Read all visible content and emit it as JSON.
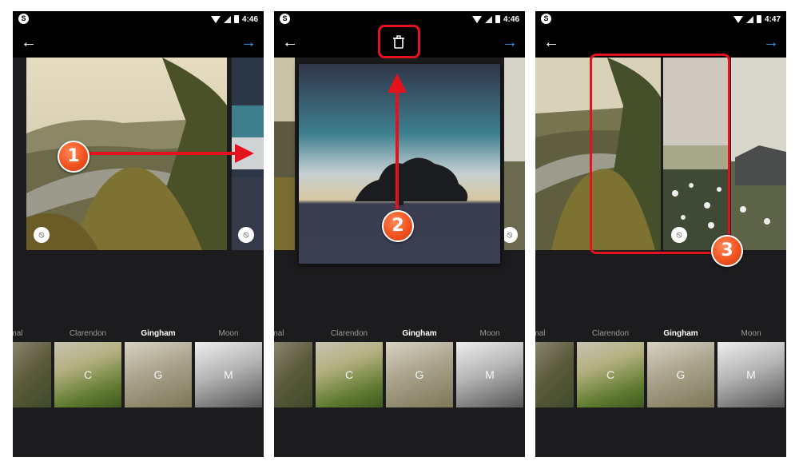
{
  "status": {
    "time_1": "4:46",
    "time_2": "4:46",
    "time_3": "4:47"
  },
  "toolbar": {
    "back_icon": "back-arrow-icon",
    "next_icon": "next-arrow-icon",
    "delete_icon": "trash-icon"
  },
  "colors": {
    "accent": "#3897f0",
    "annotation": "#e3121c",
    "background": "#1c1c1e"
  },
  "filters": [
    {
      "name": "ormal",
      "letter": ""
    },
    {
      "name": "Clarendon",
      "letter": "C"
    },
    {
      "name": "Gingham",
      "letter": "G"
    },
    {
      "name": "Moon",
      "letter": "M"
    }
  ],
  "steps": {
    "step_1": "1",
    "step_2": "2",
    "step_3": "3"
  }
}
